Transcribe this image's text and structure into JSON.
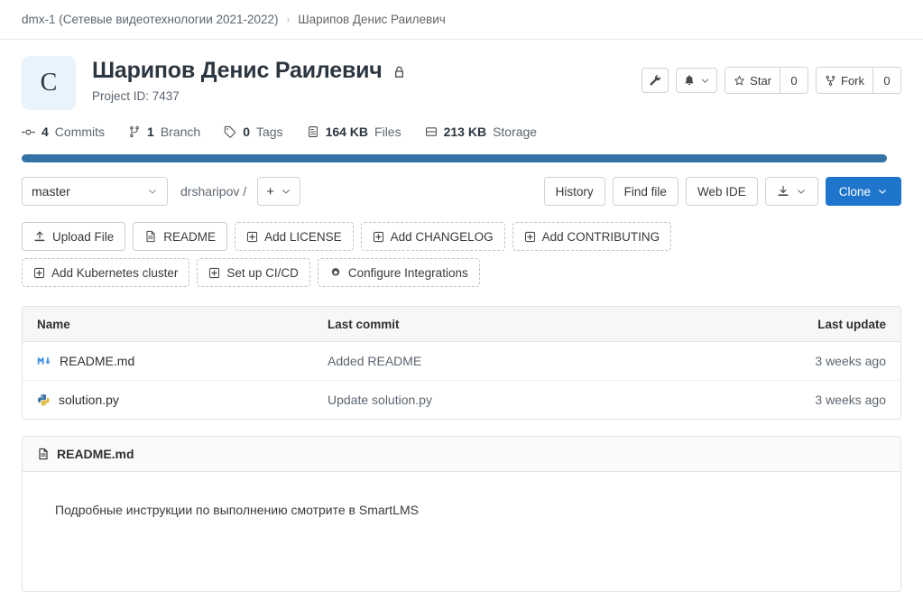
{
  "breadcrumb": {
    "group": "dmx-1 (Сетевые видеотехнологии 2021-2022)",
    "separator": "›",
    "project": "Шарипов Денис Раилевич"
  },
  "project": {
    "avatar_letter": "С",
    "title": "Шарипов Денис Раилевич",
    "visibility_icon": "lock-icon",
    "project_id_label": "Project ID: 7437"
  },
  "header_actions": {
    "wrench_icon": "wrench-icon",
    "notifications_icon": "bell-icon",
    "notifications_caret": "chevron-down-icon",
    "star_label": "Star",
    "star_count": "0",
    "star_icon": "star-icon",
    "fork_label": "Fork",
    "fork_count": "0",
    "fork_icon": "fork-icon"
  },
  "stats": [
    {
      "icon": "commit-icon",
      "value": "4",
      "label": "Commits"
    },
    {
      "icon": "branch-icon",
      "value": "1",
      "label": "Branch"
    },
    {
      "icon": "tag-icon",
      "value": "0",
      "label": "Tags"
    },
    {
      "icon": "file-icon",
      "value": "164 KB",
      "label": "Files"
    },
    {
      "icon": "storage-icon",
      "value": "213 KB",
      "label": "Storage"
    }
  ],
  "language_bar": {
    "segments": [
      {
        "name": "Python",
        "color": "#3572a5",
        "percent": 100
      }
    ]
  },
  "toolbar": {
    "branch": "master",
    "branch_caret": "chevron-down-icon",
    "path": "drsharipov /",
    "add_label": "+",
    "add_caret": "chevron-down-icon",
    "history_label": "History",
    "find_file_label": "Find file",
    "web_ide_label": "Web IDE",
    "download_icon": "download-icon",
    "download_caret": "chevron-down-icon",
    "clone_label": "Clone",
    "clone_caret": "chevron-down-icon",
    "clone_color": "#1f75cb"
  },
  "quick_actions": [
    {
      "label": "Upload File",
      "icon": "upload-icon",
      "dashed": false
    },
    {
      "label": "README",
      "icon": "doc-icon",
      "dashed": false
    },
    {
      "label": "Add LICENSE",
      "icon": "plus-box-icon",
      "dashed": true
    },
    {
      "label": "Add CHANGELOG",
      "icon": "plus-box-icon",
      "dashed": true
    },
    {
      "label": "Add CONTRIBUTING",
      "icon": "plus-box-icon",
      "dashed": true
    },
    {
      "label": "Add Kubernetes cluster",
      "icon": "plus-box-icon",
      "dashed": true
    },
    {
      "label": "Set up CI/CD",
      "icon": "plus-box-icon",
      "dashed": true
    },
    {
      "label": "Configure Integrations",
      "icon": "gear-icon",
      "dashed": true
    }
  ],
  "file_table": {
    "headers": {
      "name": "Name",
      "last_commit": "Last commit",
      "last_update": "Last update"
    },
    "rows": [
      {
        "icon": "markdown-icon",
        "name": "README.md",
        "commit": "Added README",
        "update": "3 weeks ago"
      },
      {
        "icon": "python-icon",
        "name": "solution.py",
        "commit": "Update solution.py",
        "update": "3 weeks ago"
      }
    ]
  },
  "readme": {
    "icon": "doc-icon",
    "title": "README.md",
    "body": "Подробные инструкции по выполнению смотрите в SmartLMS"
  }
}
